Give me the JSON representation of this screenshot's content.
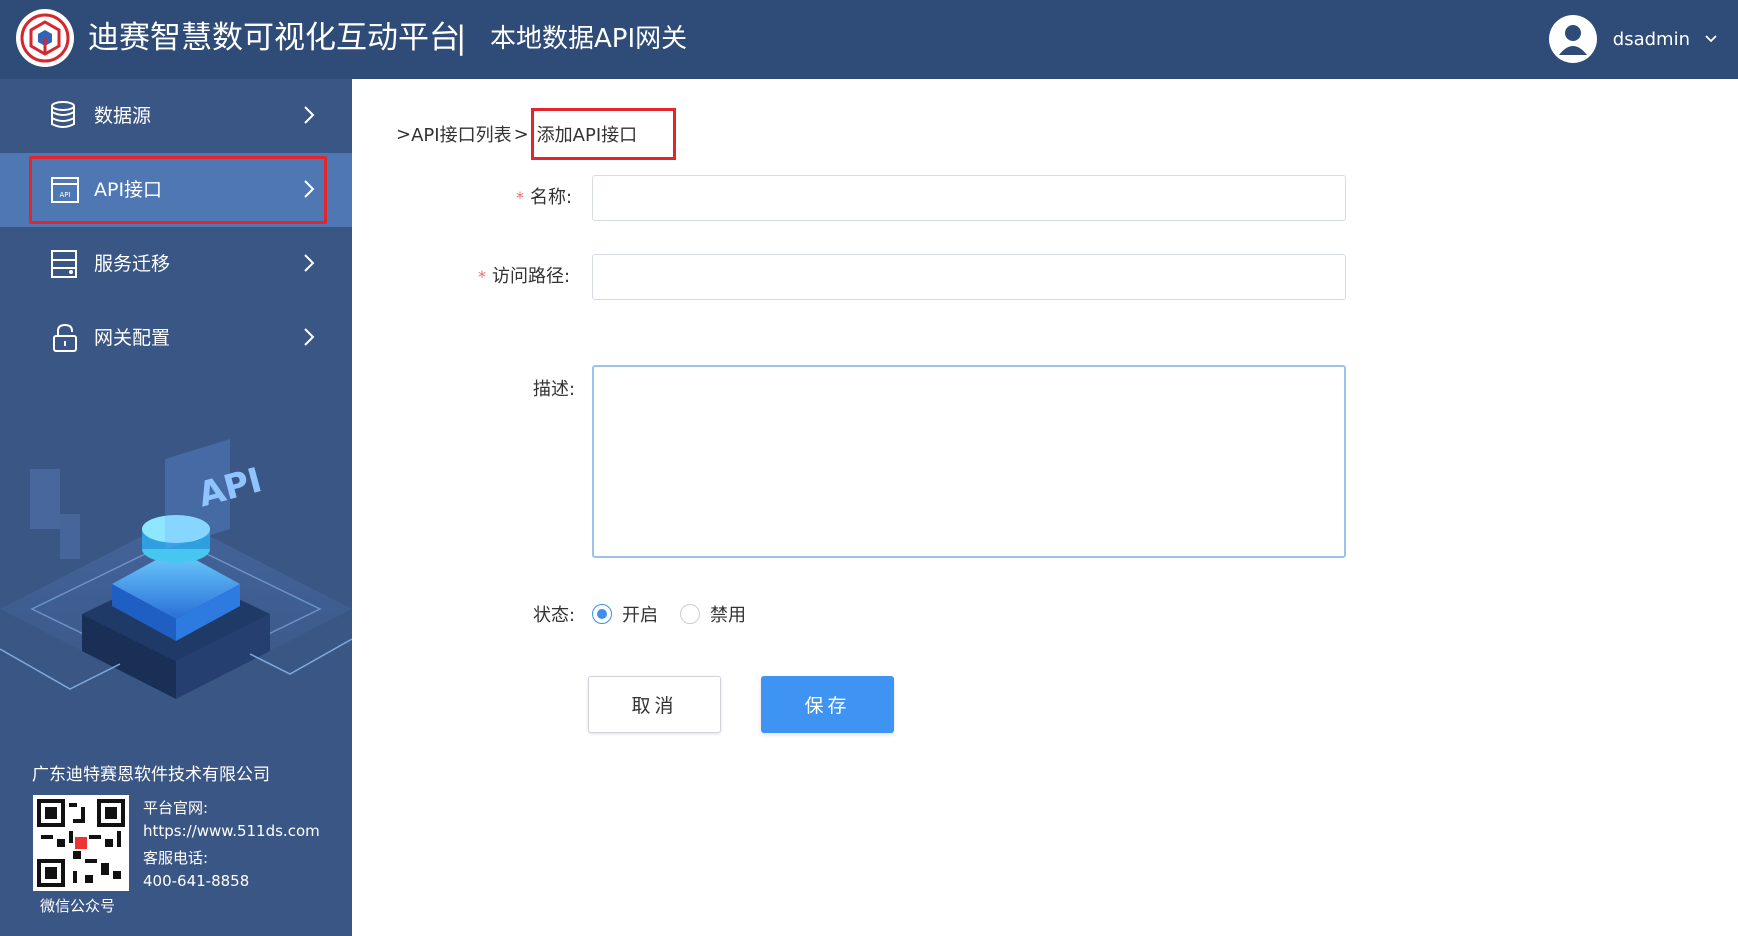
{
  "header": {
    "title": "迪赛智慧数可视化互动平台",
    "separator": "|",
    "subtitle": "本地数据API网关",
    "username": "dsadmin"
  },
  "sidebar": {
    "items": [
      {
        "label": "数据源",
        "icon": "database-icon"
      },
      {
        "label": "API接口",
        "icon": "api-window-icon",
        "active": true
      },
      {
        "label": "服务迁移",
        "icon": "server-migrate-icon"
      },
      {
        "label": "网关配置",
        "icon": "lock-icon"
      }
    ],
    "illustration_text": "API",
    "footer": {
      "company": "广东迪特赛恩软件技术有限公司",
      "website_label": "平台官网:",
      "website": "https://www.511ds.com",
      "phone_label": "客服电话:",
      "phone": "400-641-8858",
      "qr_caption": "微信公众号"
    }
  },
  "breadcrumb": {
    "prefix": ">",
    "parent": "API接口列表",
    "separator": ">",
    "current": "添加API接口"
  },
  "form": {
    "name_label": "名称:",
    "name_value": "",
    "path_label": "访问路径:",
    "path_value": "",
    "desc_label": "描述:",
    "desc_value": "",
    "status_label": "状态:",
    "status_options": [
      "开启",
      "禁用"
    ],
    "status_selected": "开启",
    "required_mark": "*"
  },
  "buttons": {
    "cancel": "取消",
    "save": "保存"
  },
  "colors": {
    "header_bg": "#2f4b77",
    "sidebar_bg": "#3a5685",
    "active_item_bg": "#4f77b4",
    "highlight_red": "#e3262c",
    "primary_blue": "#3f93f2",
    "required_red": "#f06a6a"
  }
}
